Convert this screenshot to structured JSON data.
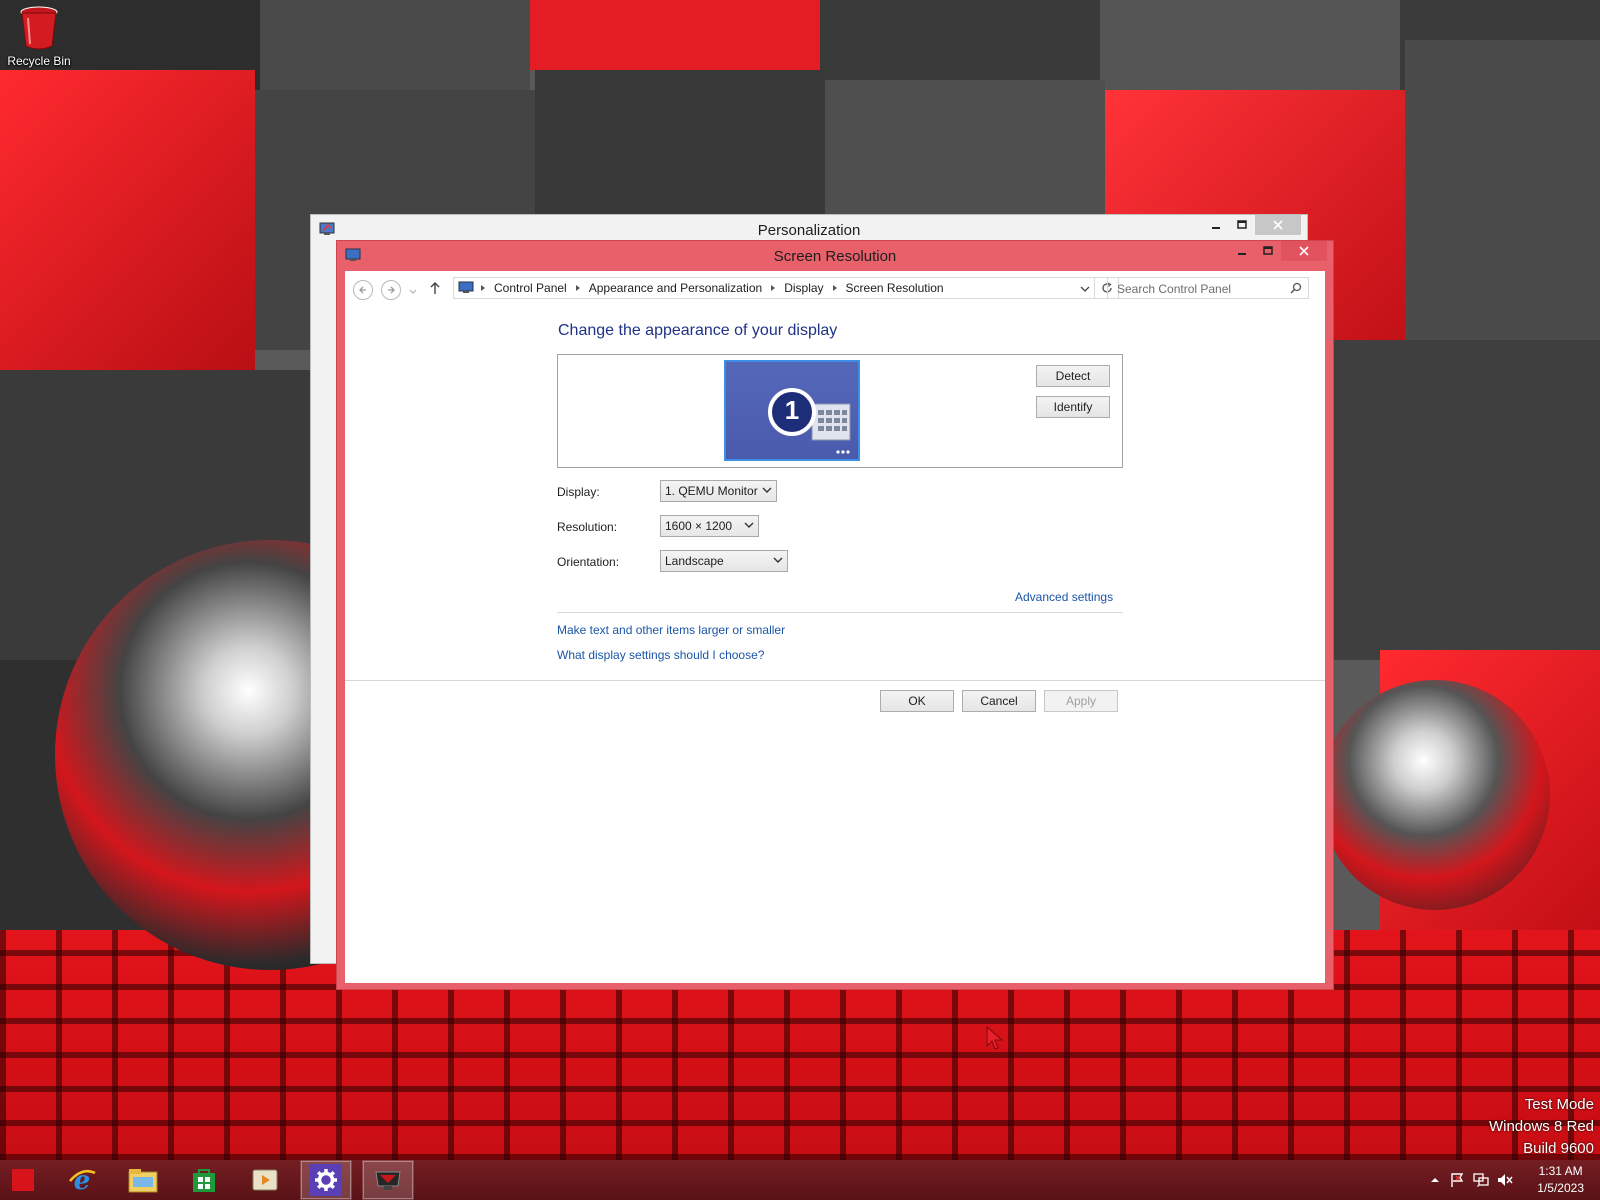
{
  "desktop": {
    "icons": [
      {
        "label": "Recycle Bin",
        "icon": "recycle-bin-icon"
      }
    ],
    "watermark": [
      "Test Mode",
      "Windows 8 Red",
      "Build 9600"
    ]
  },
  "background_window": {
    "title": "Personalization"
  },
  "window": {
    "title": "Screen Resolution",
    "accent": "#e8606a",
    "breadcrumbs": [
      "Control Panel",
      "Appearance and Personalization",
      "Display",
      "Screen Resolution"
    ],
    "search_placeholder": "Search Control Panel",
    "heading": "Change the appearance of your display",
    "monitor_number": "1",
    "buttons": {
      "detect": "Detect",
      "identify": "Identify",
      "ok": "OK",
      "cancel": "Cancel",
      "apply": "Apply"
    },
    "fields": {
      "display": {
        "label": "Display:",
        "value": "1. QEMU Monitor"
      },
      "resolution": {
        "label": "Resolution:",
        "value": "1600 × 1200"
      },
      "orientation": {
        "label": "Orientation:",
        "value": "Landscape"
      }
    },
    "links": {
      "advanced": "Advanced settings",
      "text_size": "Make text and other items larger or smaller",
      "help": "What display settings should I choose?"
    }
  },
  "taskbar": {
    "pinned": [
      "start-button",
      "internet-explorer-icon",
      "file-explorer-icon",
      "store-icon",
      "media-player-icon",
      "settings-icon",
      "display-settings-icon"
    ],
    "clock": {
      "time": "1:31 AM",
      "date": "1/5/2023"
    }
  }
}
